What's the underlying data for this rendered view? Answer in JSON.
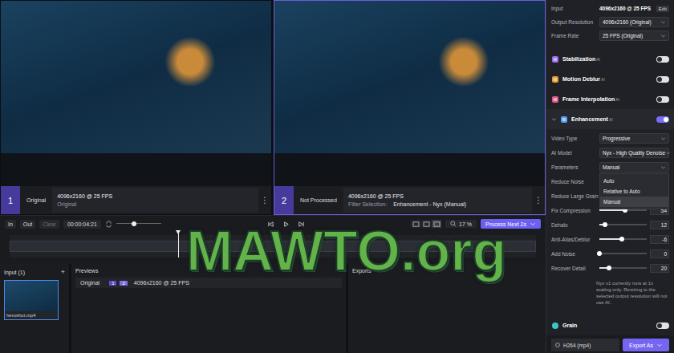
{
  "viewers": [
    {
      "number": "1",
      "label": "Original",
      "resolution": "4096x2160 @ 25 FPS",
      "detail_label": "",
      "detail": "Original",
      "menu": "⋮",
      "selected": false
    },
    {
      "number": "2",
      "label": "Not Processed",
      "resolution": "4096x2160 @ 25 FPS",
      "detail_label": "Filter Selection:",
      "detail": "Enhancement - Nyx (Manual)",
      "menu": "⋮",
      "selected": true
    }
  ],
  "timeline": {
    "in": "In",
    "out": "Out",
    "clear": "Clear",
    "timecode": "00:00:04:21",
    "volume": 0.4,
    "view_modes": [
      {
        "selected": false
      },
      {
        "selected": false
      },
      {
        "selected": true
      }
    ],
    "zoom": "17 %",
    "process_button": "Process Next 2s",
    "playhead": 0.32
  },
  "input_panel": {
    "title": "Input (1)",
    "add": "+",
    "files": [
      {
        "name": "heroshot.mp4",
        "selected": true
      }
    ]
  },
  "previews_panel": {
    "title": "Previews",
    "rows": [
      {
        "label": "Original",
        "badges": [
          "1",
          "2"
        ],
        "info": "4096x2160 @ 25 FPS"
      }
    ]
  },
  "exports_panel": {
    "title": "Exports"
  },
  "sidebar": {
    "input": {
      "label": "Input",
      "value": "4096x2160 @ 25 FPS",
      "edit": "Edit"
    },
    "output_settings": [
      {
        "label": "Output Resolution",
        "value": "4096x2160 (Original)"
      },
      {
        "label": "Frame Rate",
        "value": "25 FPS (Original)"
      }
    ],
    "filters": [
      {
        "name": "Stabilization",
        "badge": "AI",
        "on": false,
        "expanded": false,
        "color": "#9b6cf0"
      },
      {
        "name": "Motion Deblur",
        "badge": "AI",
        "on": false,
        "expanded": false,
        "color": "#e0a030"
      },
      {
        "name": "Frame Interpolation",
        "badge": "AI",
        "on": false,
        "expanded": false,
        "color": "#e05a8a"
      },
      {
        "name": "Enhancement",
        "badge": "AI",
        "on": true,
        "expanded": true,
        "color": "#5aa0f0"
      }
    ],
    "enhancement_settings": [
      {
        "kind": "select",
        "label": "Video Type",
        "value": "Progressive",
        "expanded": false
      },
      {
        "kind": "select",
        "label": "AI Model",
        "value": "Nyx - High Quality Denoise",
        "expanded": false
      },
      {
        "kind": "select",
        "label": "Parameters",
        "value": "Manual",
        "expanded": true,
        "options": [
          {
            "label": "Auto",
            "selected": false
          },
          {
            "label": "Relative to Auto",
            "selected": false
          },
          {
            "label": "Manual",
            "selected": true
          }
        ]
      },
      {
        "kind": "covered",
        "label": "Reduce Noise"
      },
      {
        "kind": "covered",
        "label": "Reduce Large Grain"
      },
      {
        "kind": "slider",
        "label": "Fix Compression",
        "value": "54",
        "level": 0.54
      },
      {
        "kind": "slider",
        "label": "Dehalo",
        "value": "12",
        "level": 0.12
      },
      {
        "kind": "slider",
        "label": "Anti-Alias/Deblur",
        "value": "-6",
        "level": 0.47
      },
      {
        "kind": "slider",
        "label": "Add Noise",
        "value": "0",
        "level": 0.0
      },
      {
        "kind": "slider",
        "label": "Recover Detail",
        "value": "20",
        "level": 0.2
      }
    ],
    "note": "Nyx v1 currently runs at 1x scaling only. Resizing to the selected output resolution will not use AI.",
    "post_filters": [
      {
        "name": "Grain",
        "on": false,
        "color": "#3ec6c0"
      }
    ],
    "export": {
      "format": "H264 (mp4)",
      "button": "Export As"
    }
  },
  "watermark": {
    "text": "MAWTO.org"
  }
}
